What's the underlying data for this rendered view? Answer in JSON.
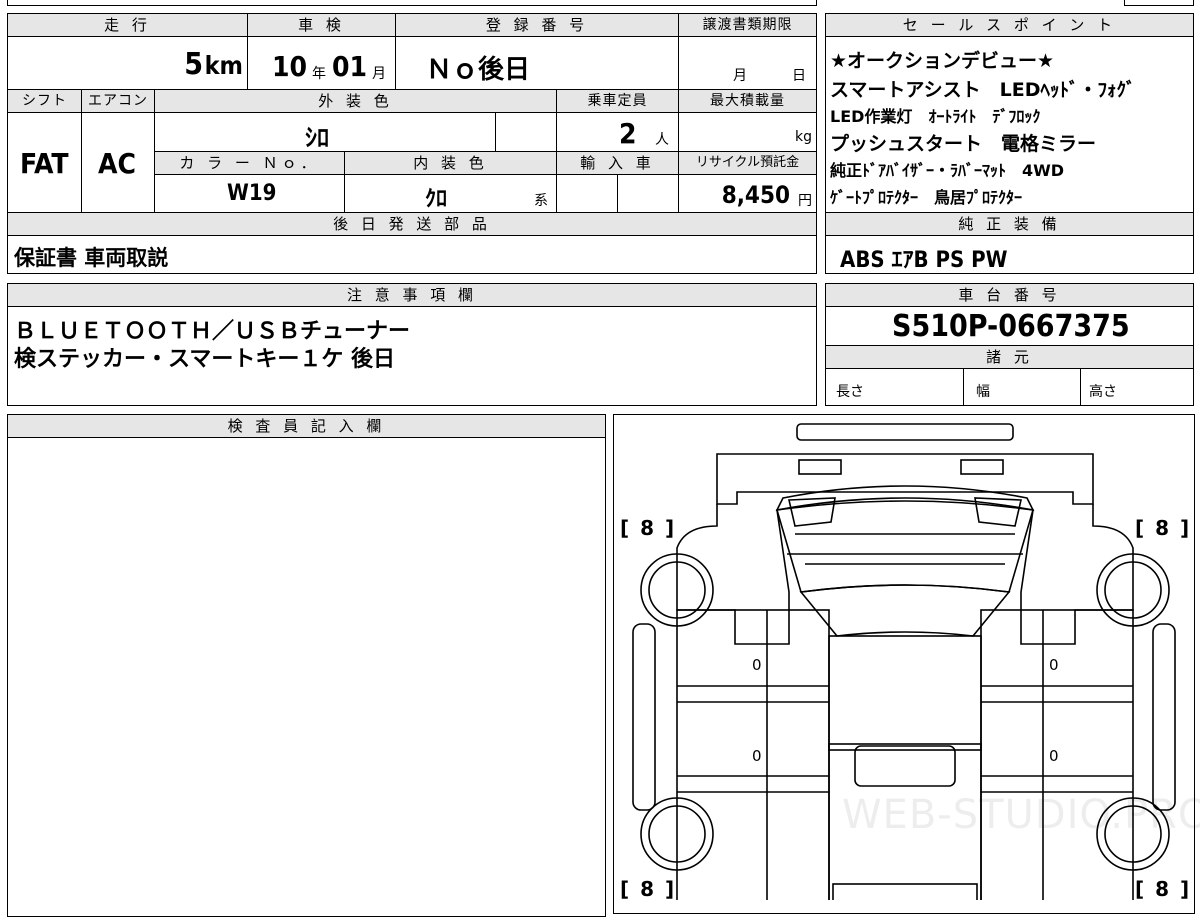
{
  "top": {
    "mileage_label": "走 行",
    "mileage_value": "5",
    "mileage_unit": "km",
    "inspection_label": "車 検",
    "inspection_year": "10",
    "inspection_year_unit": "年",
    "inspection_month": "01",
    "inspection_month_unit": "月",
    "reg_label": "登 録 番 号",
    "reg_value": "Ｎｏ後日",
    "transfer_label": "譲渡書類期限",
    "transfer_month_unit": "月",
    "transfer_day_unit": "日"
  },
  "spec": {
    "shift_label": "シフト",
    "shift_value": "FAT",
    "ac_label": "エアコン",
    "ac_value": "AC",
    "ext_color_label": "外 装 色",
    "ext_color_value": "ｼﾛ",
    "capacity_label": "乗車定員",
    "capacity_value": "2",
    "capacity_unit": "人",
    "maxload_label": "最大積載量",
    "maxload_unit": "kg",
    "colorno_label": "カ ラ ー Ｎｏ．",
    "colorno_value": "W19",
    "int_color_label": "内 装 色",
    "int_color_value": "ｸﾛ",
    "int_color_suffix": "系",
    "import_label": "輸 入 車",
    "recycle_label": "リサイクル預託金",
    "recycle_value": "8,450",
    "recycle_unit": "円"
  },
  "later_parts": {
    "label": "後 日 発 送 部 品",
    "value": "保証書 車両取説"
  },
  "sales_points": {
    "label": "セ ー ル ス ポ イ ン ト",
    "lines": [
      "★オークションデビュー★",
      "スマートアシスト　LEDﾍｯﾄﾞ・ﾌｫｸﾞ",
      "LED作業灯　ｵｰﾄﾗｲﾄ　ﾃﾞﾌﾛｯｸ",
      "プッシュスタート　電格ミラー",
      "純正ﾄﾞｱﾊﾞｲｻﾞｰ・ﾗﾊﾞｰﾏｯﾄ　4WD",
      "ｹﾞｰﾄﾌﾟﾛﾃｸﾀｰ　鳥居ﾌﾟﾛﾃｸﾀｰ"
    ]
  },
  "equipment": {
    "label": "純 正 装 備",
    "value": "ABS ｴｱB PS PW"
  },
  "notes": {
    "label": "注 意 事 項 欄",
    "line1": "ＢＬＵＥＴＯＯＴＨ／ＵＳＢチューナー",
    "line2": "検ステッカー・スマートキー１ケ 後日"
  },
  "chassis": {
    "label": "車 台 番 号",
    "value": "S510P-0667375"
  },
  "dimensions": {
    "label": "諸 元",
    "length_label": "長さ",
    "width_label": "幅",
    "height_label": "高さ"
  },
  "inspector": {
    "label": "検 査 員 記 入 欄"
  },
  "diagram": {
    "tire_tread_fl": "[ 8 ]",
    "tire_tread_fr": "[ 8 ]",
    "tire_tread_rl": "[ 8 ]",
    "tire_tread_rr": "[ 8 ]",
    "mark_left_front": "0",
    "mark_right_front": "0",
    "mark_left_rear": "0",
    "mark_right_rear": "0",
    "watermark": "WEB-STUDIO.PRO"
  }
}
